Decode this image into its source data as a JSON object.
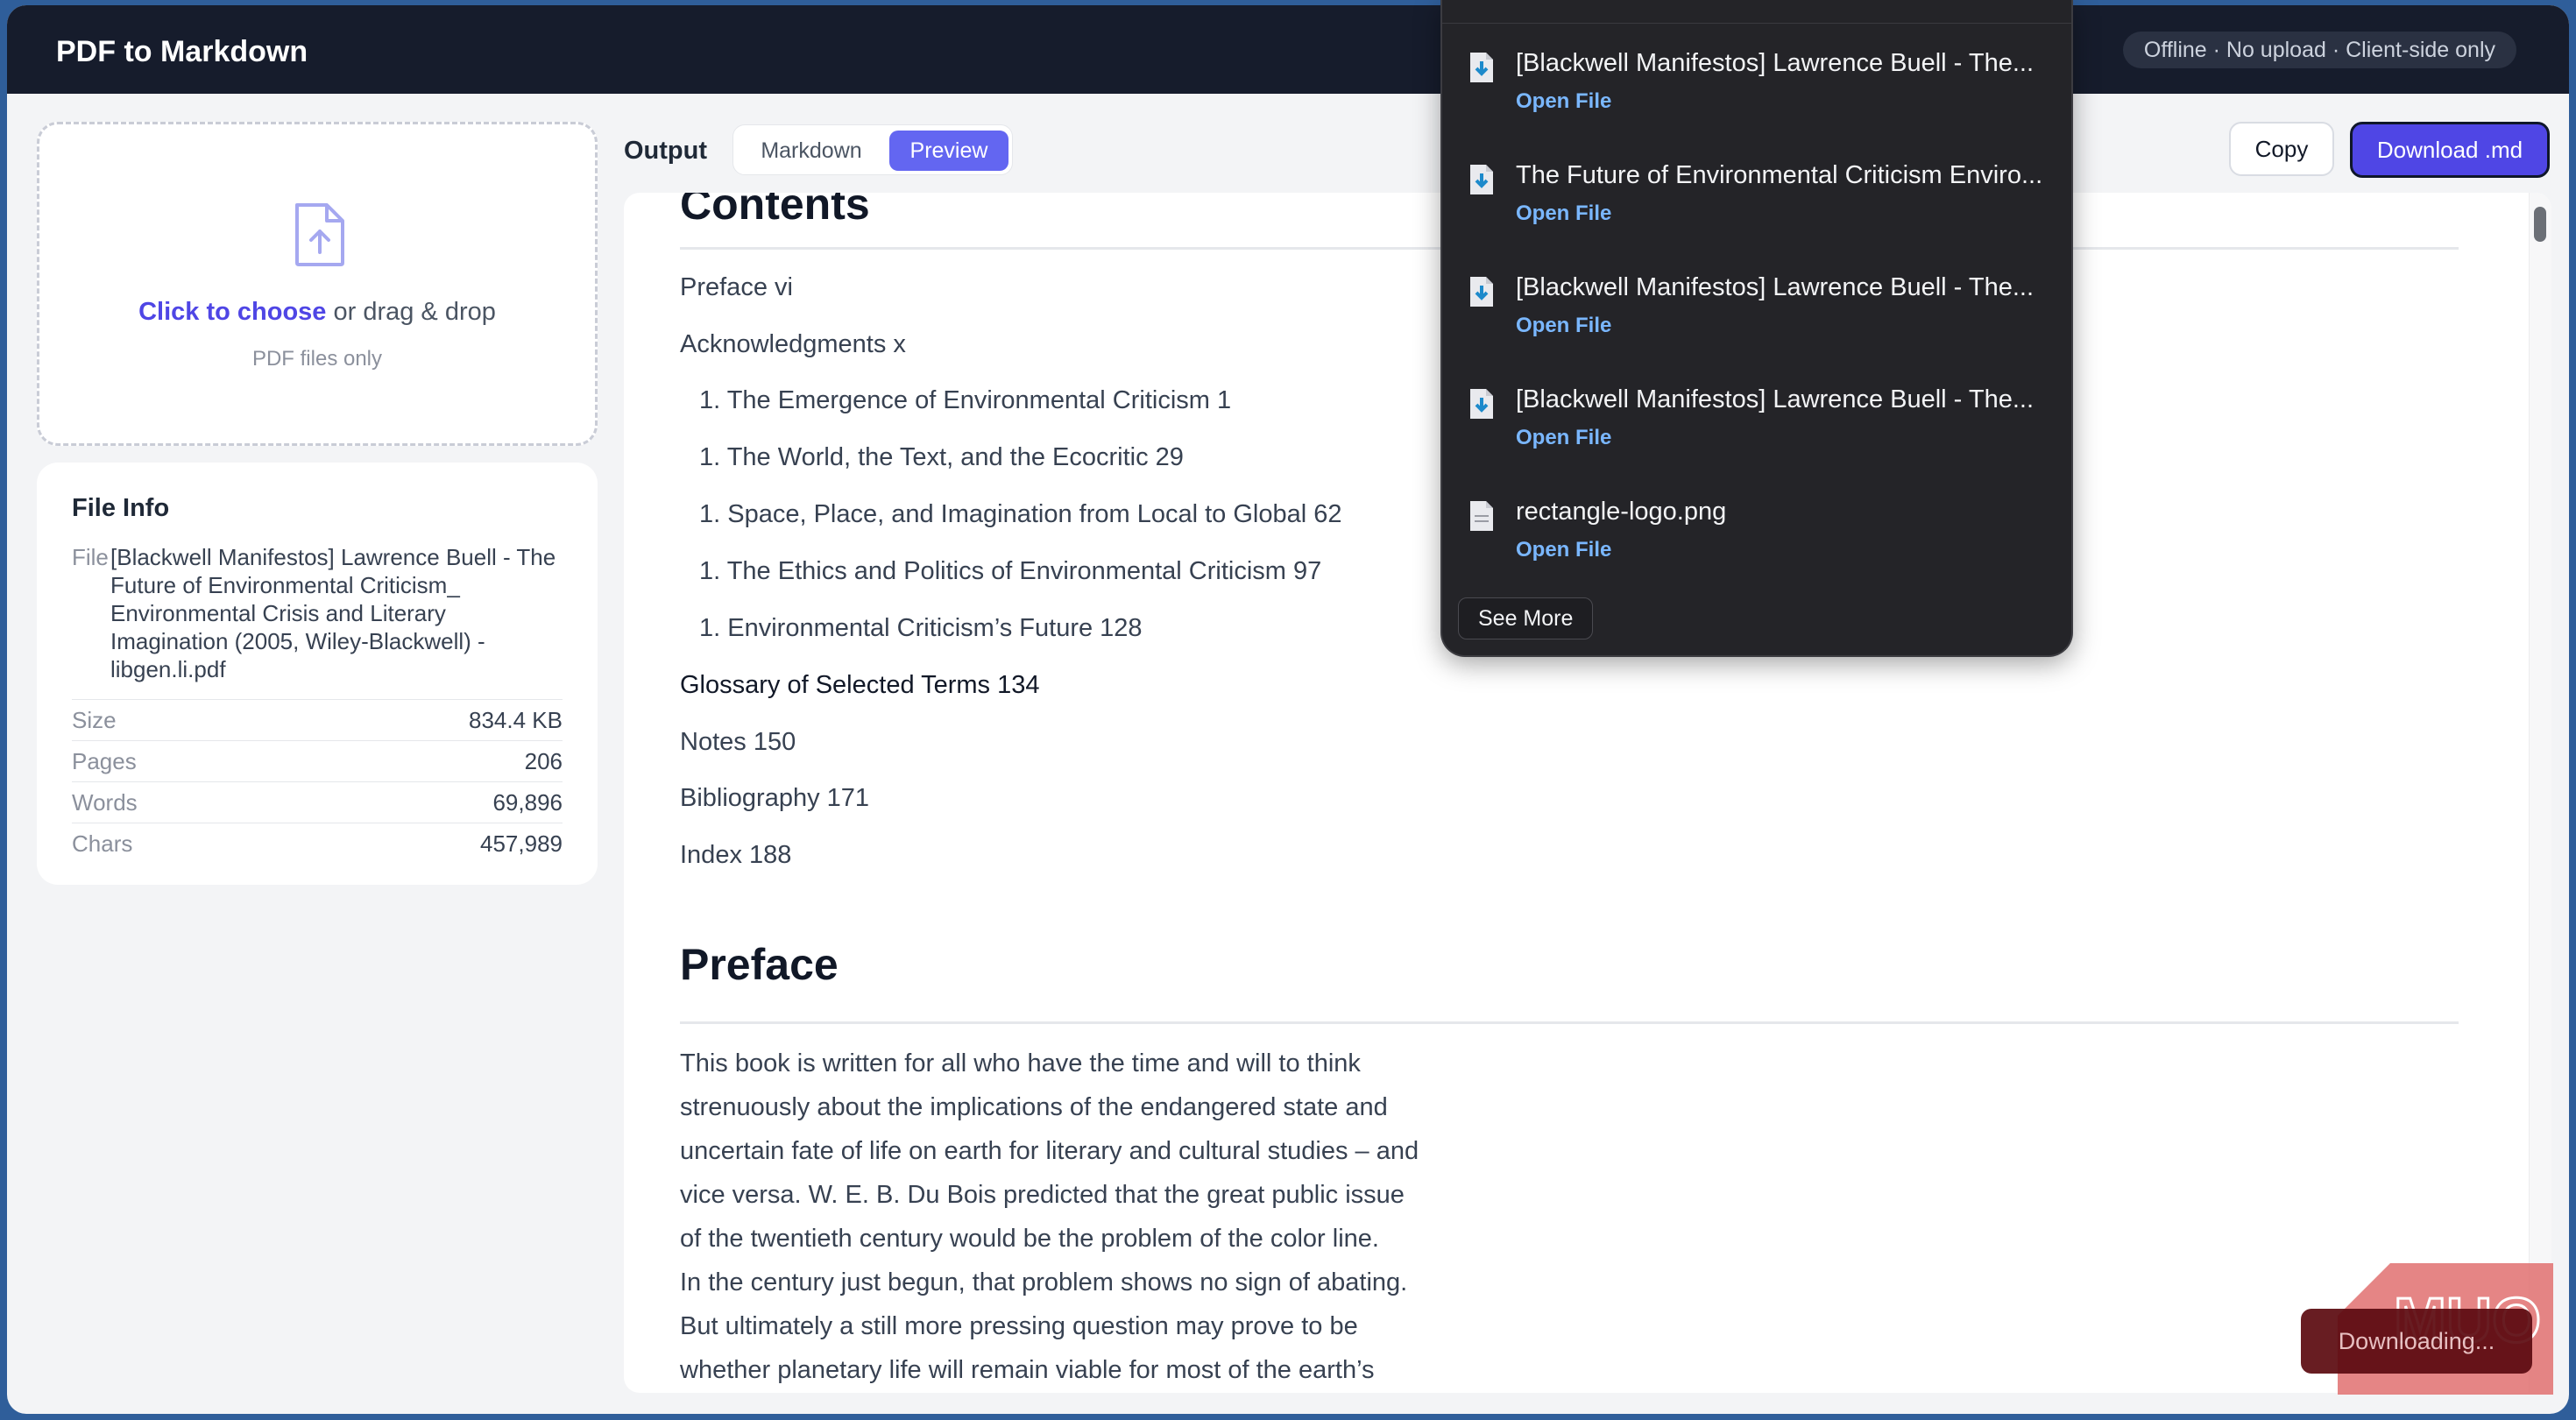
{
  "app": {
    "title": "PDF to Markdown",
    "status": "Offline · No upload · Client-side only"
  },
  "upload": {
    "choose": "Click to choose",
    "drag": " or drag & drop",
    "hint": "PDF files only"
  },
  "file_info": {
    "title": "File Info",
    "file_label": "File",
    "file_value": "[Blackwell Manifestos] Lawrence Buell - The Future of Environmental Criticism_ Environmental Crisis and Literary Imagination (2005, Wiley-Blackwell) - libgen.li.pdf",
    "rows": [
      {
        "label": "Size",
        "value": "834.4 KB"
      },
      {
        "label": "Pages",
        "value": "206"
      },
      {
        "label": "Words",
        "value": "69,896"
      },
      {
        "label": "Chars",
        "value": "457,989"
      }
    ]
  },
  "output": {
    "label": "Output",
    "tab_markdown": "Markdown",
    "tab_preview": "Preview",
    "copy": "Copy",
    "download": "Download .md"
  },
  "preview": {
    "contents_heading": "Contents",
    "toc": [
      "Preface vi",
      "Acknowledgments x",
      "1. The Emergence of Environmental Criticism 1",
      "1. The World, the Text, and the Ecocritic 29",
      "1. Space, Place, and Imagination from Local to Global 62",
      "1. The Ethics and Politics of Environmental Criticism 97",
      "1. Environmental Criticism’s Future 128",
      "Glossary of Selected Terms 134",
      "Notes 150",
      "Bibliography 171",
      "Index 188"
    ],
    "preface_heading": "Preface",
    "preface_lines": [
      "This book is written for all who have the time and will to think",
      "strenuously about the implications of the endangered state and",
      "uncertain fate of life on earth for literary and cultural studies – and",
      "vice versa. W. E. B. Du Bois predicted that the great public issue",
      "of the twentieth century would be the problem of the color line.",
      "In the century just begun, that problem shows no sign of abating.",
      "But ultimately a still more pressing question may prove to be",
      "whether planetary life will remain viable for most of the earth’s"
    ]
  },
  "downloads": {
    "items": [
      {
        "name": "[Blackwell Manifestos] Lawrence Buell - The...",
        "action": "Open File",
        "icon": "pdf-file-icon"
      },
      {
        "name": "The Future of Environmental Criticism Enviro...",
        "action": "Open File",
        "icon": "pdf-file-icon"
      },
      {
        "name": "[Blackwell Manifestos] Lawrence Buell - The...",
        "action": "Open File",
        "icon": "pdf-file-icon"
      },
      {
        "name": "[Blackwell Manifestos] Lawrence Buell - The...",
        "action": "Open File",
        "icon": "pdf-file-icon"
      },
      {
        "name": "rectangle-logo.png",
        "action": "Open File",
        "icon": "image-file-icon"
      }
    ],
    "see_more": "See More"
  },
  "toast": {
    "text": "Downloading..."
  },
  "watermark": {
    "text": "MUO"
  },
  "colors": {
    "accent": "#4f46e5",
    "topbar": "#161c2c",
    "link": "#7ab7ff"
  }
}
